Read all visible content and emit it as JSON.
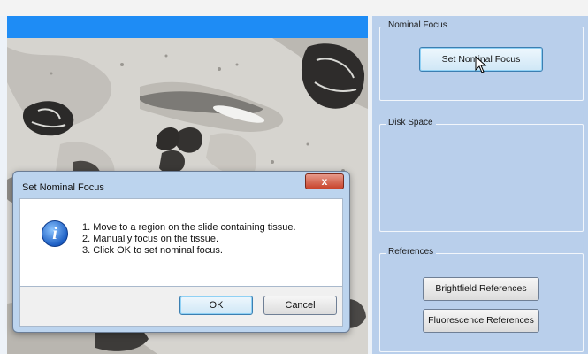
{
  "right_panel": {
    "nominal_focus": {
      "legend": "Nominal Focus",
      "button_label": "Set Nominal Focus"
    },
    "disk_space": {
      "legend": "Disk Space"
    },
    "references": {
      "legend": "References",
      "brightfield_label": "Brightfield References",
      "fluorescence_label": "Fluorescence References"
    }
  },
  "dialog": {
    "title": "Set Nominal Focus",
    "close_symbol": "x",
    "icon": "info-icon",
    "lines": [
      "1. Move to a region on the slide containing tissue.",
      "2. Manually focus on the tissue.",
      "3. Click OK to set nominal focus."
    ],
    "ok_label": "OK",
    "cancel_label": "Cancel"
  },
  "colors": {
    "title_bar": "#1e8cf5",
    "panel_bg": "#b9cfeb",
    "dialog_frame": "#bcd4ee"
  }
}
